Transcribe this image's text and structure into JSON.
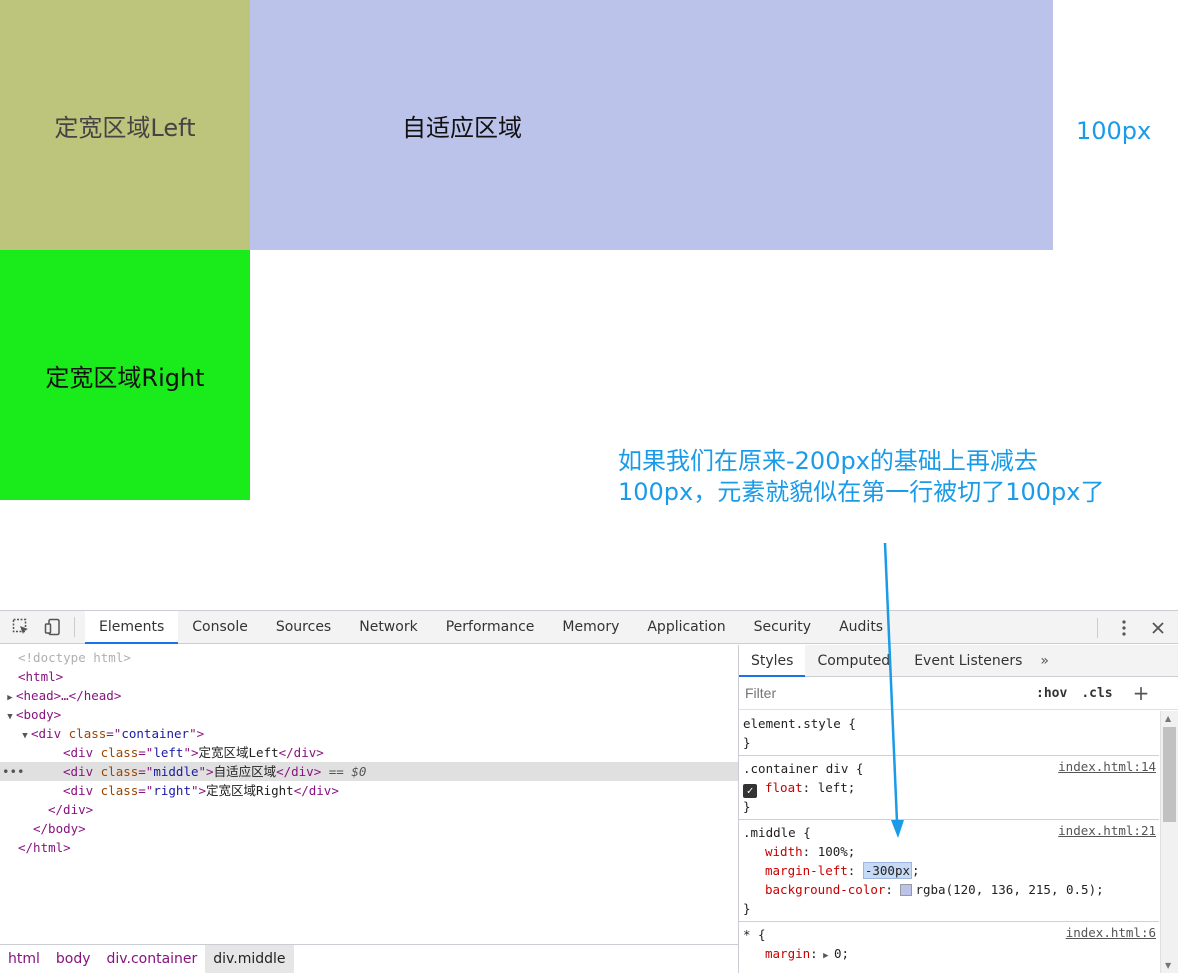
{
  "viewport": {
    "left_box": {
      "text": "定宽区域Left",
      "bg": "#bdc47b",
      "color": "#444444"
    },
    "middle_box": {
      "text": "自适应区域",
      "bg": "#bbc3eb",
      "color": "#111111"
    },
    "right_box": {
      "text": "定宽区域Right",
      "bg": "#1aeb1a",
      "color": "#111111"
    },
    "label_100px": "100px",
    "annotation_line1": "如果我们在原来-200px的基础上再减去",
    "annotation_line2": "100px，元素就貌似在第一行被切了100px了",
    "accent": "#1a9be8"
  },
  "devtools": {
    "tabs": [
      "Elements",
      "Console",
      "Sources",
      "Network",
      "Performance",
      "Memory",
      "Application",
      "Security",
      "Audits"
    ],
    "active_tab": "Elements",
    "dom": {
      "doctype": "<!doctype html>",
      "html_open": "<html>",
      "head": "<head>…</head>",
      "body_open": "<body>",
      "container_open": "<div class=\"container\">",
      "left_text": "定宽区域Left",
      "middle_text": "自适应区域",
      "middle_suffix": " == $0",
      "right_text": "定宽区域Right",
      "div_close": "</div>",
      "body_close": "</body>",
      "html_close": "</html>"
    },
    "breadcrumbs": [
      "html",
      "body",
      "div.container",
      "div.middle"
    ],
    "styles": {
      "tabs": [
        "Styles",
        "Computed",
        "Event Listeners"
      ],
      "more": "»",
      "filter_placeholder": "Filter",
      "hov": ":hov",
      "cls": ".cls",
      "plus": "+",
      "element_style": "element.style {",
      "close_brace": "}",
      "rule1": {
        "selector": ".container div {",
        "src": "index.html:14",
        "prop": "float",
        "val": "left;"
      },
      "rule2": {
        "selector": ".middle {",
        "src": "index.html:21",
        "width_prop": "width",
        "width_val": "100%;",
        "ml_prop": "margin-left",
        "ml_val": "-300px",
        "bg_prop": "background-color",
        "bg_val": "rgba(120, 136, 215, 0.5);"
      },
      "rule3": {
        "selector": "* {",
        "src": "index.html:6",
        "prop": "margin",
        "val": "0;"
      }
    }
  }
}
